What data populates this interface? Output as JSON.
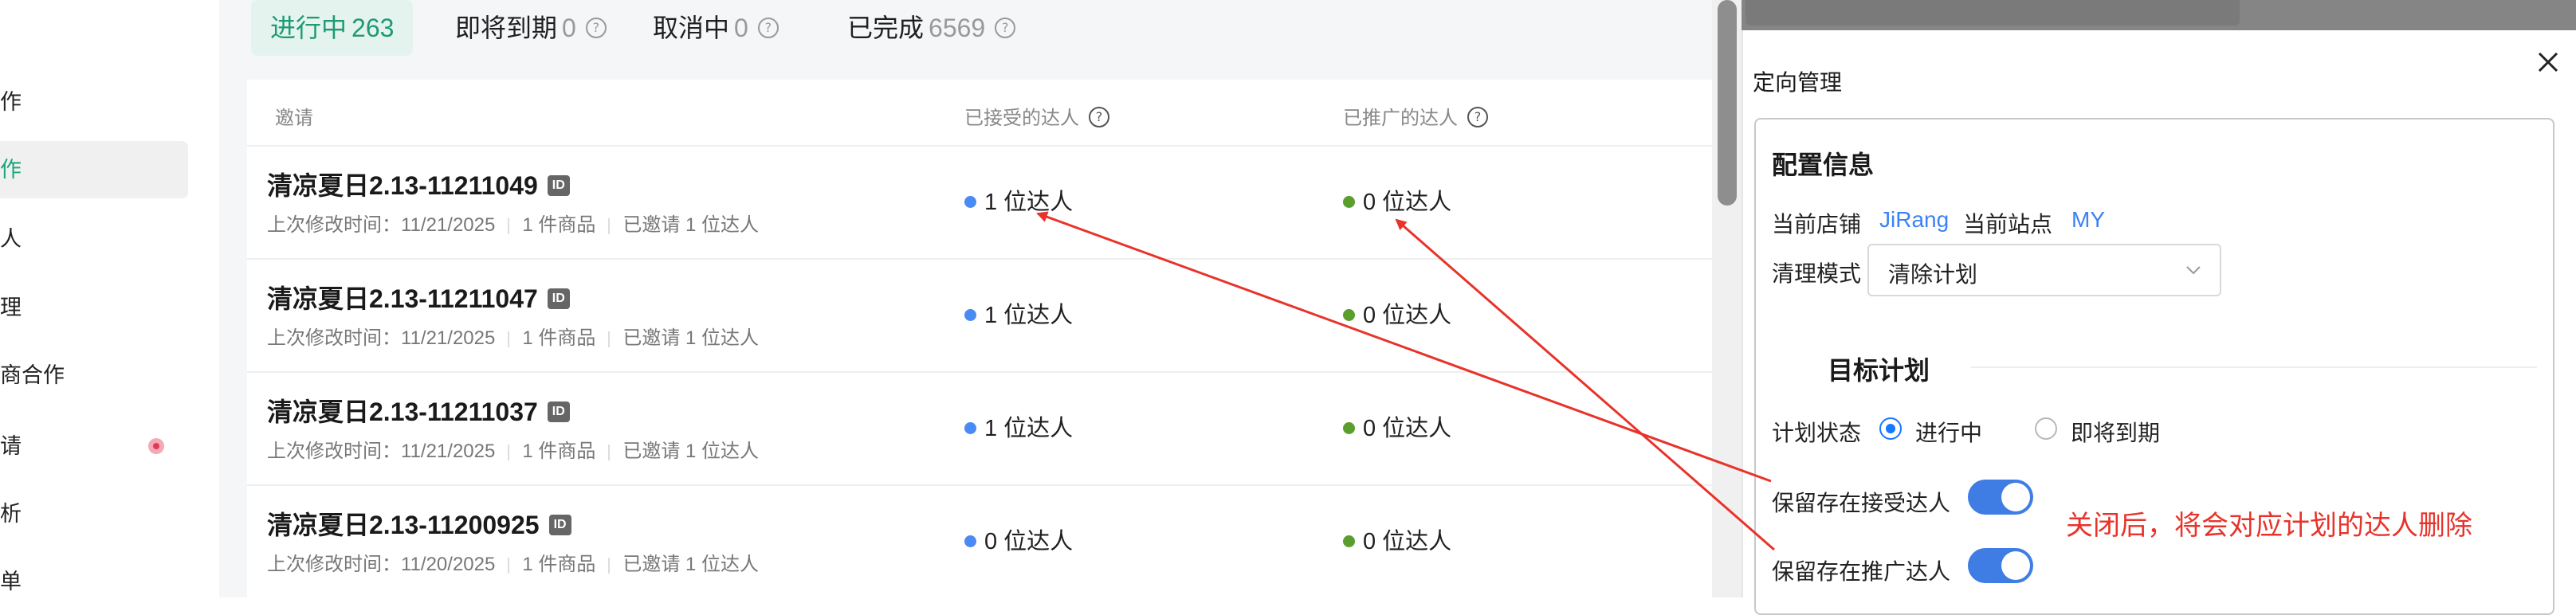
{
  "sidebar": {
    "items": [
      {
        "label": "作",
        "active": false,
        "badge": false
      },
      {
        "label": "作",
        "active": true,
        "badge": false
      },
      {
        "label": "人",
        "active": false,
        "badge": false
      },
      {
        "label": "理",
        "active": false,
        "badge": false
      },
      {
        "label": "商合作",
        "active": false,
        "badge": false
      },
      {
        "label": "请",
        "active": false,
        "badge": true
      },
      {
        "label": "析",
        "active": false,
        "badge": false
      },
      {
        "label": "单",
        "active": false,
        "badge": false
      }
    ]
  },
  "tabs": [
    {
      "label": "进行中",
      "count": "263",
      "active": true,
      "help": false
    },
    {
      "label": "即将到期",
      "count": "0",
      "active": false,
      "help": true
    },
    {
      "label": "取消中",
      "count": "0",
      "active": false,
      "help": true
    },
    {
      "label": "已完成",
      "count": "6569",
      "active": false,
      "help": true
    }
  ],
  "table": {
    "headers": {
      "invite": "邀请",
      "accepted": "已接受的达人",
      "promoted": "已推广的达人"
    },
    "rows": [
      {
        "title": "清凉夏日2.13-11211049",
        "id_badge": "ID",
        "modified": "上次修改时间：11/21/2025",
        "products": "1 件商品",
        "invited": "已邀请 1 位达人",
        "accepted": "1 位达人",
        "promoted": "0 位达人"
      },
      {
        "title": "清凉夏日2.13-11211047",
        "id_badge": "ID",
        "modified": "上次修改时间：11/21/2025",
        "products": "1 件商品",
        "invited": "已邀请 1 位达人",
        "accepted": "1 位达人",
        "promoted": "0 位达人"
      },
      {
        "title": "清凉夏日2.13-11211037",
        "id_badge": "ID",
        "modified": "上次修改时间：11/21/2025",
        "products": "1 件商品",
        "invited": "已邀请 1 位达人",
        "accepted": "1 位达人",
        "promoted": "0 位达人"
      },
      {
        "title": "清凉夏日2.13-11200925",
        "id_badge": "ID",
        "modified": "上次修改时间：11/20/2025",
        "products": "1 件商品",
        "invited": "已邀请 1 位达人",
        "accepted": "0 位达人",
        "promoted": "0 位达人"
      }
    ]
  },
  "drawer": {
    "title": "定向管理",
    "config_title": "配置信息",
    "store_label": "当前店铺",
    "store_value": "JiRang",
    "site_label": "当前站点",
    "site_value": "MY",
    "mode_label": "清理模式",
    "mode_value": "清除计划",
    "target_heading": "目标计划",
    "status_label": "计划状态",
    "status_options": [
      {
        "label": "进行中",
        "checked": true
      },
      {
        "label": "即将到期",
        "checked": false
      }
    ],
    "keep_accepted_label": "保留存在接受达人",
    "keep_accepted_on": true,
    "keep_promoted_label": "保留存在推广达人",
    "keep_promoted_on": true
  },
  "annotation": {
    "text": "关闭后，将会对应计划的达人删除",
    "color": "#e8332a"
  },
  "colors": {
    "accent_green": "#1d9a74",
    "link_blue": "#3b82f6",
    "toggle_blue": "#3f7ce3",
    "accepted_dot": "#4a8af4",
    "promoted_dot": "#5a9e2e"
  }
}
